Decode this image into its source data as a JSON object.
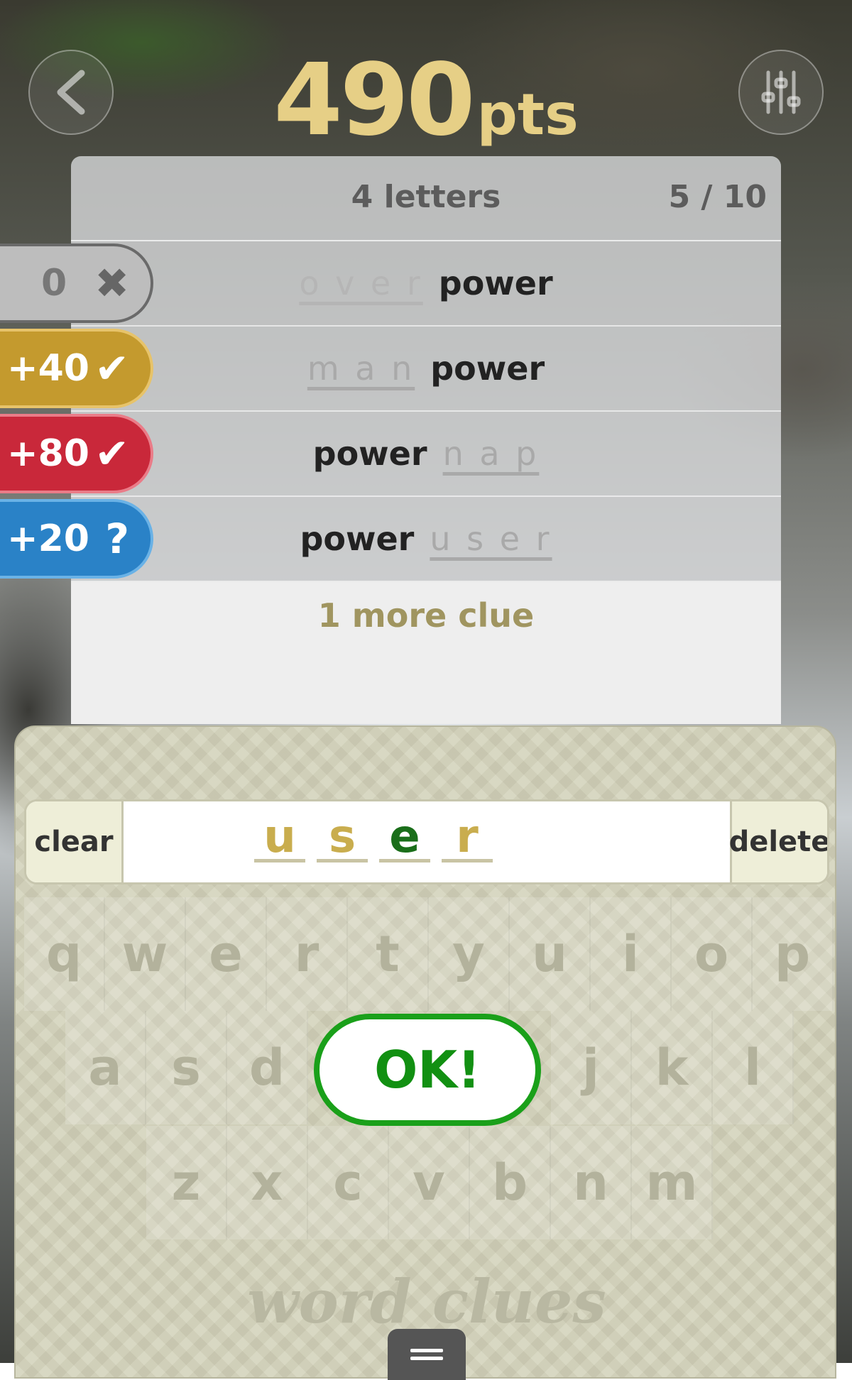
{
  "header": {
    "score": "490",
    "score_unit": "pts"
  },
  "panel": {
    "title": "4 letters",
    "progress": "5 / 10"
  },
  "clues": [
    {
      "points": "0",
      "status": "✖",
      "prefix": "o v e r",
      "base": "power",
      "suffix": ""
    },
    {
      "points": "+40",
      "status": "✔",
      "prefix": "m a n",
      "base": "power",
      "suffix": ""
    },
    {
      "points": "+80",
      "status": "✔",
      "prefix": "",
      "base": "power",
      "suffix": "n a p"
    },
    {
      "points": "+20",
      "status": "?",
      "prefix": "",
      "base": "power",
      "suffix": "u s e r"
    }
  ],
  "more_clues": "1 more clue",
  "entry": {
    "clear_label": "clear",
    "delete_label": "delete",
    "letters": [
      "u",
      "s",
      "e",
      "r"
    ],
    "letter_colors": [
      "#c9ad4e",
      "#c9ad4e",
      "#1a6e1a",
      "#c9ad4e"
    ]
  },
  "keyboard": {
    "row1": [
      "q",
      "w",
      "e",
      "r",
      "t",
      "y",
      "u",
      "i",
      "o",
      "p"
    ],
    "row2_left": [
      "a",
      "s",
      "d"
    ],
    "row2_right": [
      "j",
      "k",
      "l"
    ],
    "row3": [
      "z",
      "x",
      "c",
      "v",
      "b",
      "n",
      "m"
    ],
    "ok_label": "OK!"
  },
  "brand": "word clues",
  "icons": {
    "back": "chevron-left-icon",
    "settings": "sliders-icon",
    "menu": "hamburger-icon"
  }
}
